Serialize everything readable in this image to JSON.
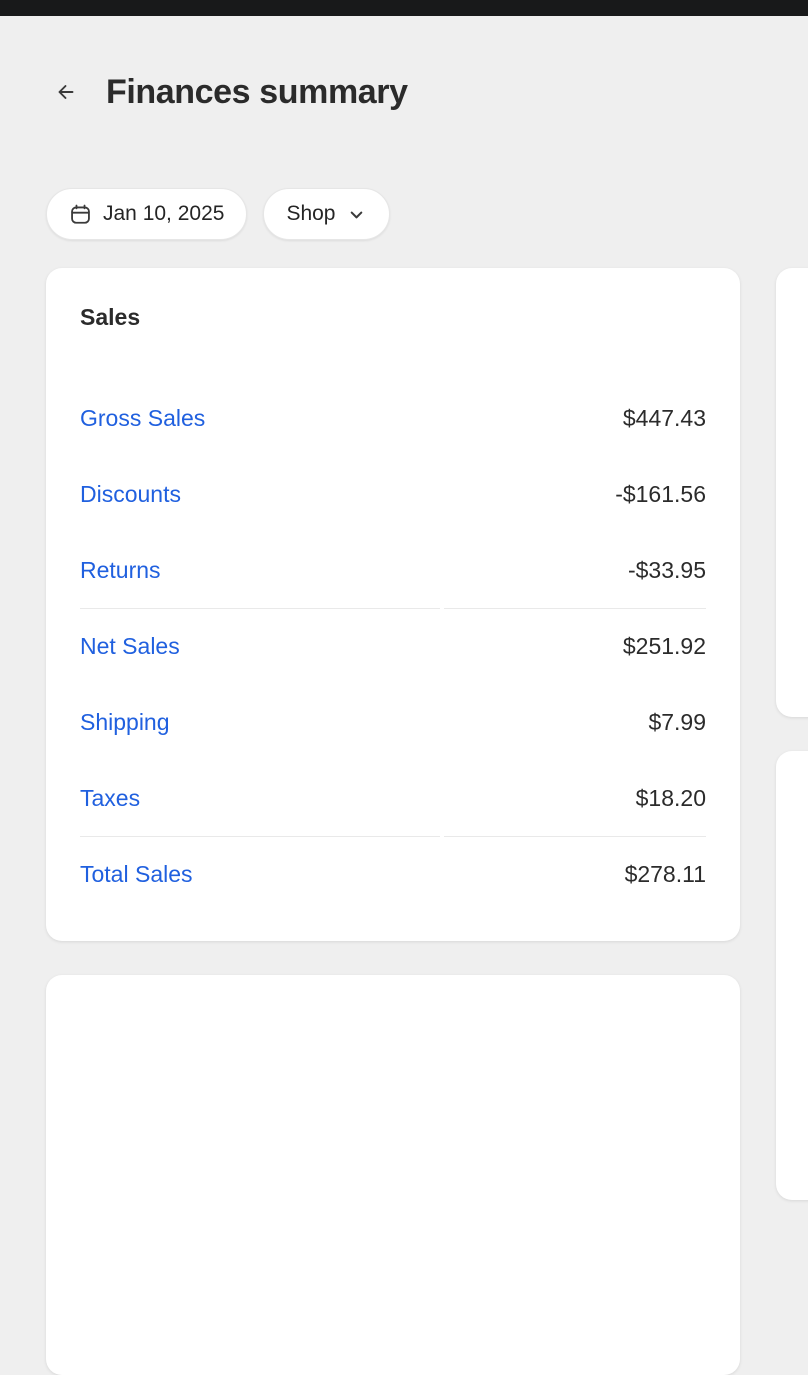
{
  "status_bar": {
    "color": "#18191a"
  },
  "header": {
    "back_icon": "arrow-left-icon",
    "title": "Finances summary"
  },
  "filters": {
    "date": {
      "icon": "calendar-icon",
      "label": "Jan 10, 2025"
    },
    "shop": {
      "label": "Shop",
      "icon": "chevron-down-icon"
    }
  },
  "theme": {
    "background": "#efefef",
    "card_background": "#ffffff",
    "link_color": "#2060df",
    "text_color": "#2b2b2b",
    "divider_color": "#e9e9e9"
  },
  "sales_card": {
    "title": "Sales",
    "rows": [
      {
        "label": "Gross Sales",
        "value": "$447.43",
        "divider_above": false
      },
      {
        "label": "Discounts",
        "value": "-$161.56",
        "divider_above": false
      },
      {
        "label": "Returns",
        "value": "-$33.95",
        "divider_above": false
      },
      {
        "label": "Net Sales",
        "value": "$251.92",
        "divider_above": true
      },
      {
        "label": "Shipping",
        "value": "$7.99",
        "divider_above": false
      },
      {
        "label": "Taxes",
        "value": "$18.20",
        "divider_above": false
      },
      {
        "label": "Total Sales",
        "value": "$278.11",
        "divider_above": true
      }
    ]
  }
}
